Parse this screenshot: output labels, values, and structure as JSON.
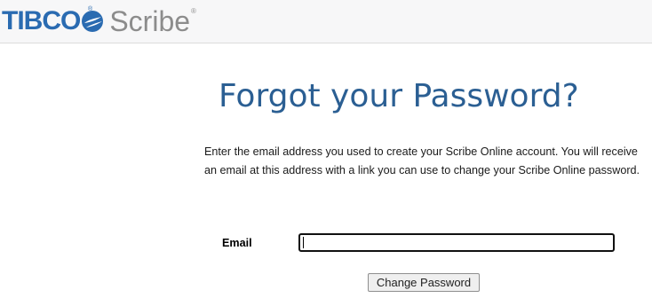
{
  "header": {
    "logo_brand": "TIBCO",
    "logo_product": "Scribe",
    "logo_registered": "®",
    "logo_mark_color": "#2a6bb1",
    "background": "#f7f7f8"
  },
  "main": {
    "title": "Forgot your Password?",
    "description": "Enter the email address you used to create your Scribe Online account. You will receive an email at this address with a link you can use to change your Scribe Online password.",
    "title_color": "#2b5f93"
  },
  "form": {
    "email_label": "Email",
    "email_value": "",
    "email_placeholder": "",
    "submit_label": "Change Password"
  }
}
